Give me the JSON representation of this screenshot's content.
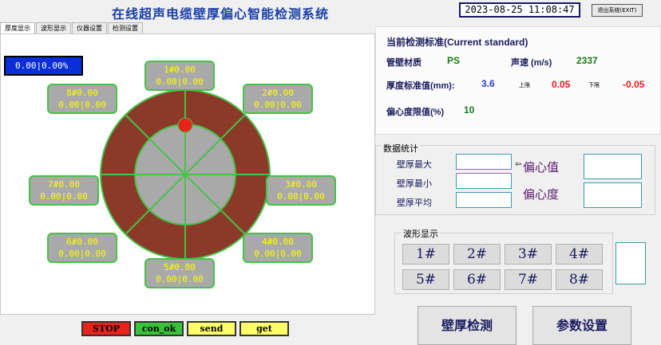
{
  "app": {
    "title": "在线超声电缆壁厚偏心智能检测系统",
    "datetime": "2023-08-25 11:08:47",
    "exit_label": "退出系统(EXIT)"
  },
  "tabs": [
    {
      "label": "厚度显示",
      "active": true
    },
    {
      "label": "波形显示",
      "active": false
    },
    {
      "label": "仪器设置",
      "active": false
    },
    {
      "label": "检测设置",
      "active": false
    }
  ],
  "overall": {
    "text": "0.00|0.00%"
  },
  "sensors": [
    {
      "id": "1#",
      "line1": "1#0.00",
      "line2": "0.00|0.00"
    },
    {
      "id": "2#",
      "line1": "2#0.00",
      "line2": "0.00|0.00"
    },
    {
      "id": "3#",
      "line1": "3#0.00",
      "line2": "0.00|0.00"
    },
    {
      "id": "4#",
      "line1": "4#0.00",
      "line2": "0.00|0.00"
    },
    {
      "id": "5#",
      "line1": "5#0.00",
      "line2": "0.00|0.00"
    },
    {
      "id": "6#",
      "line1": "6#0.00",
      "line2": "0.00|0.00"
    },
    {
      "id": "7#",
      "line1": "7#0.00",
      "line2": "0.00|0.00"
    },
    {
      "id": "8#",
      "line1": "8#0.00",
      "line2": "0.00|0.00"
    }
  ],
  "ring": {
    "outer_color": "#8b3a2a",
    "inner_color": "#a9a9a9",
    "line_color": "#46c246",
    "marker_color": "#e8231b"
  },
  "standard": {
    "title": "当前检测标准(Current standard)",
    "material_label": "管壁材质",
    "material_value": "PS",
    "speed_label": "声速 (m/s)",
    "speed_value": "2337",
    "thickness_label": "厚度标准值(mm):",
    "thickness_value": "3.6",
    "upper_label": "上限",
    "upper_value": "0.05",
    "lower_label": "下限",
    "lower_value": "-0.05",
    "ecc_limit_label": "偏心度限值(%)",
    "ecc_limit_value": "10"
  },
  "stats": {
    "title": "数据统计",
    "max_label": "壁厚最大",
    "min_label": "壁厚最小",
    "avg_label": "壁厚平均",
    "ecc_value_label": "偏心值",
    "ecc_degree_label": "偏心度"
  },
  "waveform": {
    "title": "波形显示",
    "buttons": [
      "1#",
      "2#",
      "3#",
      "4#",
      "5#",
      "6#",
      "7#",
      "8#"
    ]
  },
  "actions": {
    "thickness_detect": "壁厚检测",
    "param_settings": "参数设置"
  },
  "status": [
    {
      "label": "STOP",
      "color": "#e8231b"
    },
    {
      "label": "con_ok",
      "color": "#3ac23a"
    },
    {
      "label": "send",
      "color": "#ffff66"
    },
    {
      "label": "get",
      "color": "#ffff66"
    }
  ]
}
